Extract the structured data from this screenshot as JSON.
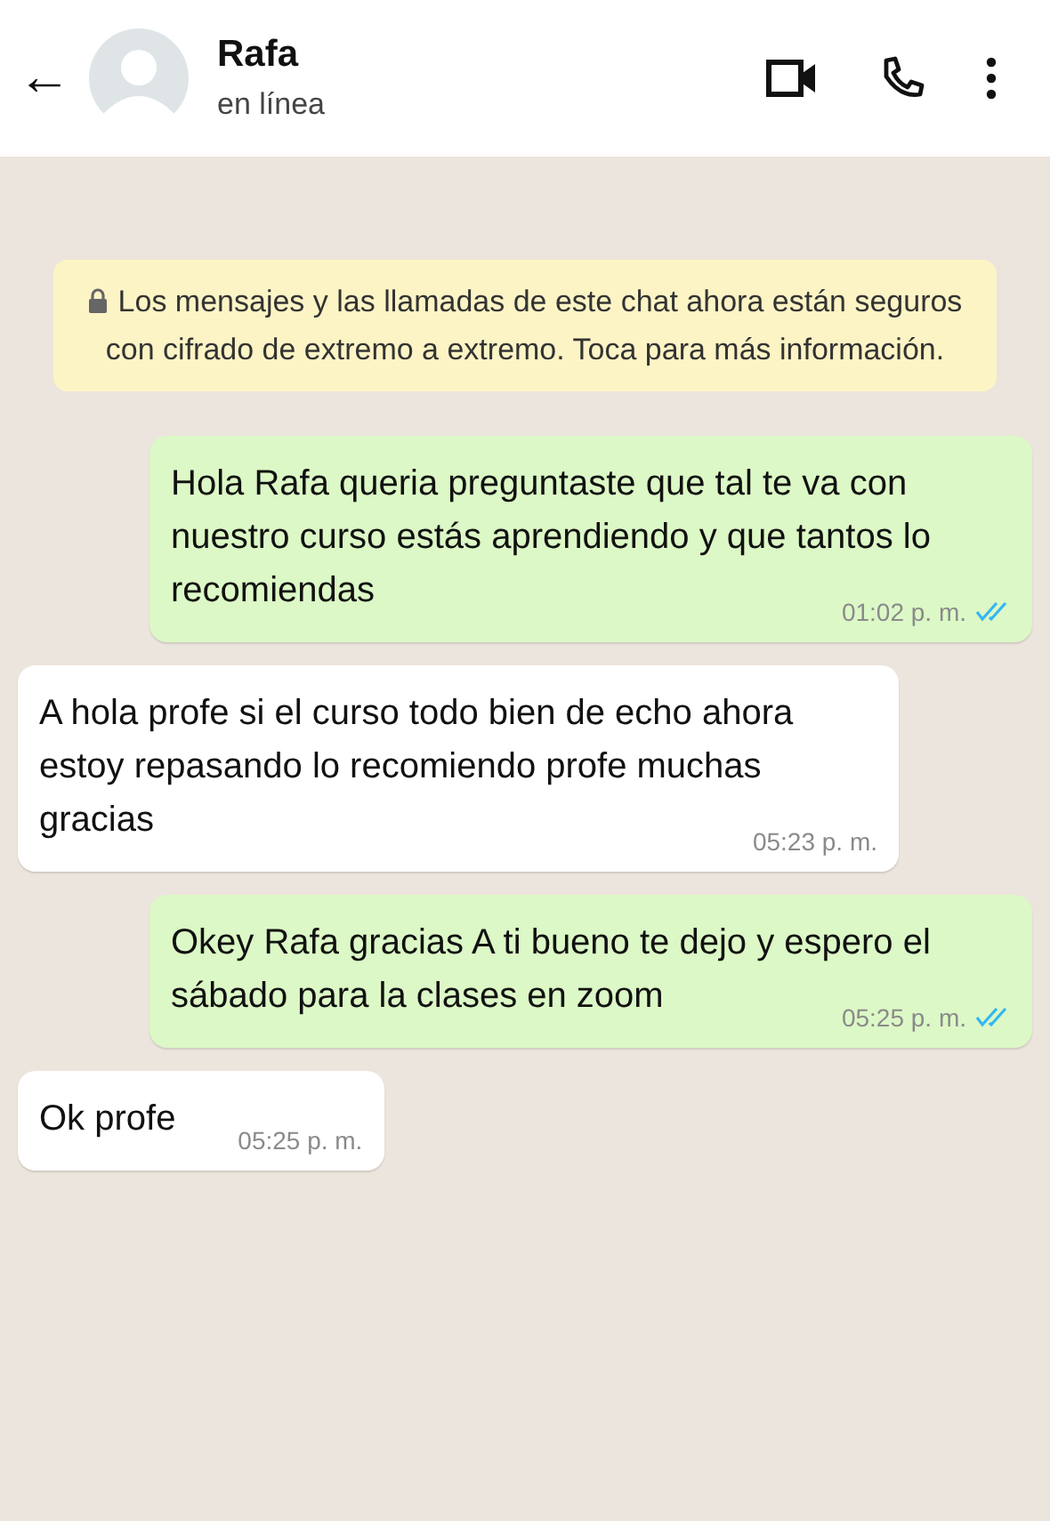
{
  "header": {
    "back": "←",
    "name": "Rafa",
    "status": "en línea"
  },
  "notice": {
    "text": "Los mensajes y las llamadas de este chat ahora están seguros con cifrado de extremo a extremo. Toca para más información."
  },
  "messages": [
    {
      "kind": "out",
      "text": "Hola Rafa queria preguntaste que tal te va con nuestro curso estás aprendiendo y que tantos lo recomiendas",
      "time": "01:02 p. m.",
      "read": true
    },
    {
      "kind": "in",
      "text": "A hola profe si el curso todo bien de echo ahora estoy repasando lo recomiendo profe muchas gracias",
      "time": "05:23 p. m."
    },
    {
      "kind": "out",
      "text": "Okey Rafa gracias A ti bueno te dejo y espero el sábado para la clases en zoom",
      "time": "05:25 p. m.",
      "read": true
    },
    {
      "kind": "in",
      "text": "Ok profe",
      "time": "05:25 p. m."
    }
  ]
}
